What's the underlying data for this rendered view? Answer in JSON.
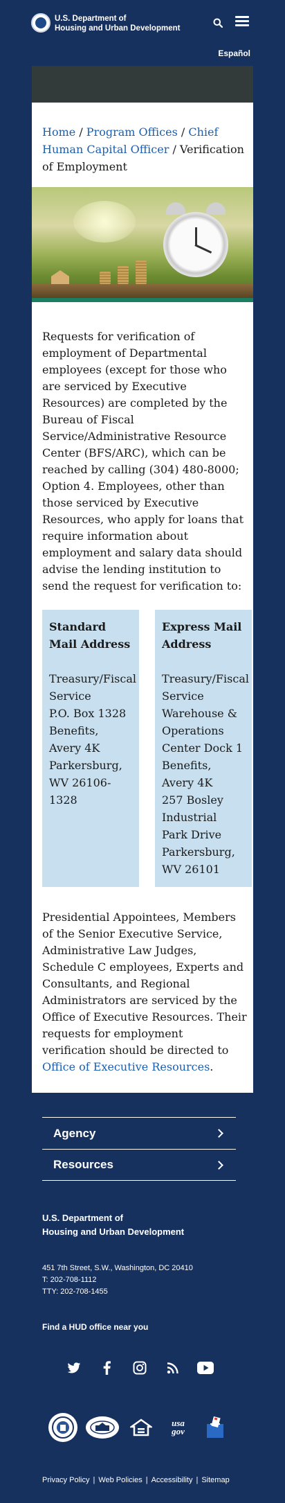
{
  "header": {
    "agency_line1": "U.S. Department of",
    "agency_line2": "Housing and Urban Development",
    "search_icon": "search-icon",
    "menu_icon": "hamburger-menu-icon"
  },
  "language_link": "Español",
  "breadcrumb": {
    "home": "Home",
    "sep": " / ",
    "program_offices": "Program Offices",
    "chief": "Chief Human Capital Officer",
    "current": "Verification of Employment"
  },
  "intro_paragraph": "Requests for verification of employment of Departmental employees (except for those who are serviced by Executive Resources) are completed by the Bureau of Fiscal Service/Administrative Resource Center (BFS/ARC), which can be reached by calling (304) 480-8000; Option 4. Employees, other than those serviced by Executive Resources, who apply for loans that require information about employment and salary data should advise the lending institution to send the request for verification to:",
  "standard_mail": {
    "title": "Standard Mail Address",
    "lines": [
      "Treasury/Fiscal Service",
      "P.O. Box 1328",
      "Benefits, Avery 4K",
      "Parkersburg, WV 26106-1328"
    ]
  },
  "express_mail": {
    "title": "Express Mail Address",
    "lines": [
      "Treasury/Fiscal Service",
      "Warehouse & Operations Center Dock 1",
      "Benefits, Avery 4K",
      "257 Bosley Industrial Park Drive",
      "Parkersburg, WV 26101"
    ]
  },
  "closing_paragraph": {
    "text": "Presidential Appointees, Members of the Senior Executive Service, Administrative Law Judges, Schedule C employees, Experts and Consultants, and Regional Administrators are serviced by the Office of Executive Resources. Their requests for employment verification should be directed to ",
    "link": "Office of Executive Resources",
    "end": "."
  },
  "footer": {
    "nav": [
      "Agency",
      "Resources"
    ],
    "title_line1": "U.S. Department of",
    "title_line2": "Housing and Urban Development",
    "address": "451 7th Street, S.W., Washington, DC 20410",
    "phone": "T: 202-708-1112",
    "tty": "TTY: 202-708-1455",
    "find_office": "Find a HUD office near you",
    "social_icons": [
      "twitter-icon",
      "facebook-icon",
      "instagram-icon",
      "rss-icon",
      "youtube-icon"
    ],
    "logos": [
      "hud-seal-logo",
      "white-house-logo",
      "equal-housing-logo",
      "usa-gov-logo",
      "vote-logo"
    ],
    "usa_gov_logo_text": "usa gov",
    "bottom_links": [
      "Privacy Policy",
      "Web Policies",
      "Accessibility",
      "Sitemap"
    ],
    "separator": "|"
  },
  "colors": {
    "navy": "#17315f",
    "link": "#1c5fae",
    "address_box": "#c7dfee",
    "dark_bar": "#323a3a"
  }
}
